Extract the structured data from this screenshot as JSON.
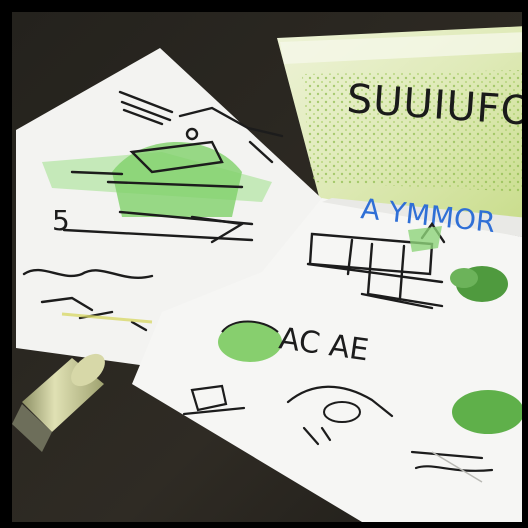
{
  "scene": {
    "description_free": true,
    "colors": {
      "table": "#2e2b25",
      "paper": "#f4f4f2",
      "bag": "#d8e6b2",
      "green": "#7fd16a",
      "ink": "#1d1d1d",
      "blue_ink": "#2f6fd6"
    }
  },
  "bag": {
    "label": "SUUIUFOR"
  },
  "right_sheet": {
    "heading": "A YMMOR",
    "caption": "AC AE"
  },
  "left_sheet": {
    "number": "5"
  }
}
